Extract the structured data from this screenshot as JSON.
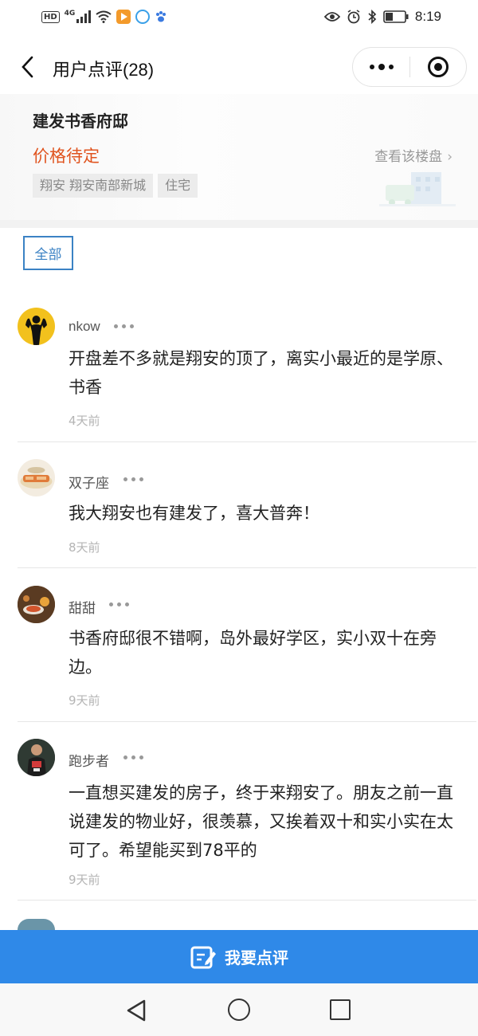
{
  "status_bar": {
    "hd": "HD",
    "network": "4G",
    "time": "8:19"
  },
  "nav": {
    "title": "用户点评(28)"
  },
  "property": {
    "name": "建发书香府邸",
    "price": "价格待定",
    "link_label": "查看该楼盘",
    "tags": [
      "翔安 翔安南部新城",
      "住宅"
    ]
  },
  "filter": {
    "label": "全部"
  },
  "comments": [
    {
      "user": "nkow",
      "text": "开盘差不多就是翔安的顶了，离实小最近的是学原、书香",
      "time": "4天前"
    },
    {
      "user": "双子座",
      "text": "我大翔安也有建发了，喜大普奔！",
      "time": "8天前"
    },
    {
      "user": "甜甜",
      "text": "书香府邸很不错啊，岛外最好学区，实小双十在旁边。",
      "time": "9天前"
    },
    {
      "user": "跑步者",
      "text": "一直想买建发的房子，终于来翔安了。朋友之前一直说建发的物业好，很羡慕，又挨着双十和实小实在太可了。希望能买到78平的",
      "time": "9天前"
    }
  ],
  "bottom_button": {
    "label": "我要点评",
    "icon": "pen-edit-icon",
    "color": "#2f89e8"
  },
  "colors": {
    "price": "#e0541f",
    "accent": "#3b82c4"
  }
}
